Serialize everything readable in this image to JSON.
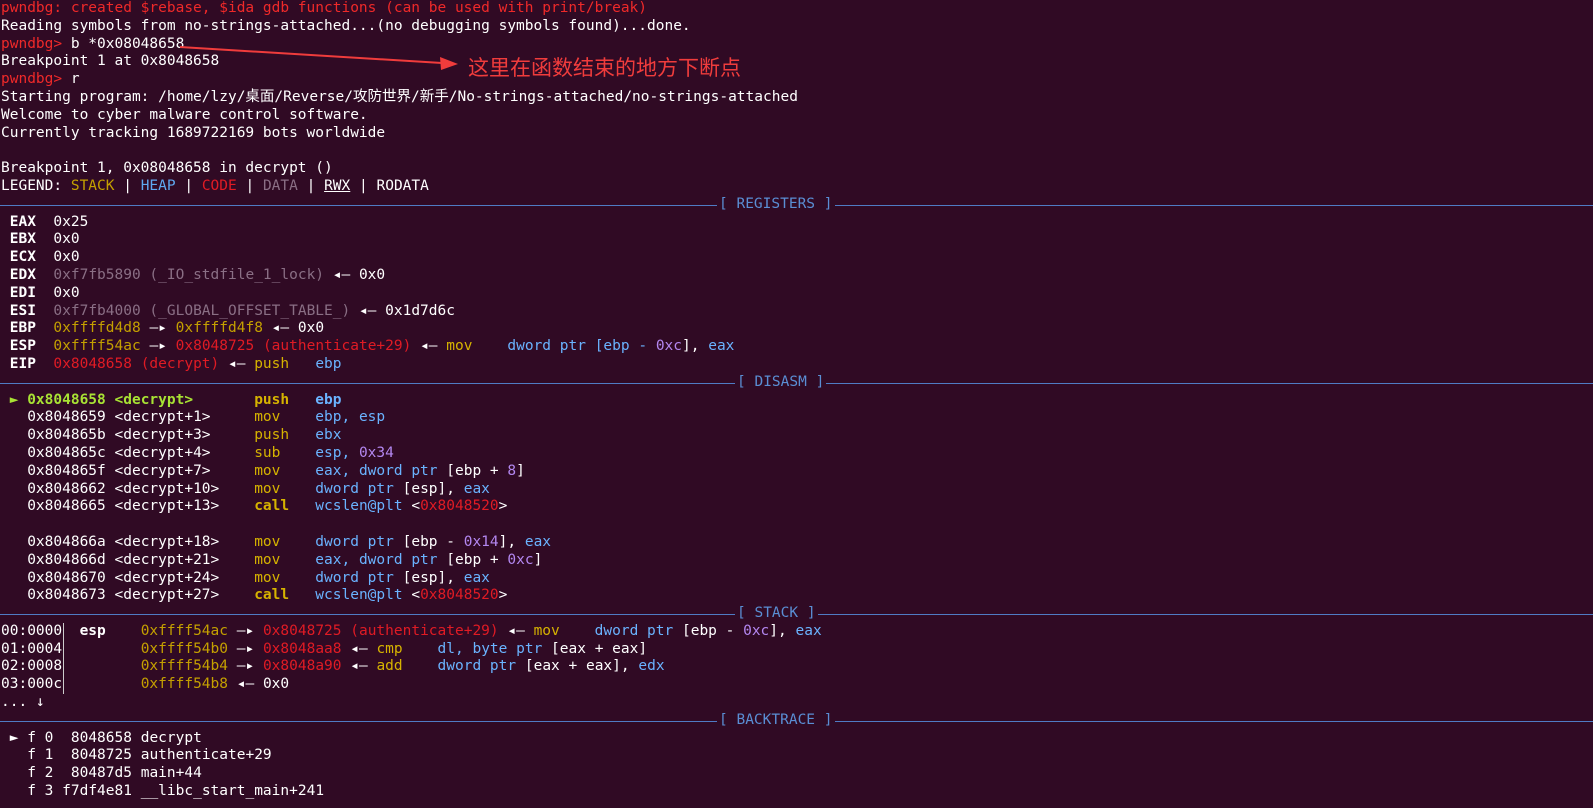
{
  "header_lines": {
    "l0_prompt": "pwndbg:",
    "l0_text": " created $rebase, $ida gdb functions (can be used with print/break)",
    "l1": "Reading symbols from no-strings-attached...(no debugging symbols found)...done.",
    "l2_prompt": "pwndbg>",
    "l2_cmd": " b *0x08048658",
    "l3": "Breakpoint 1 at 0x8048658",
    "l4_prompt": "pwndbg>",
    "l4_cmd": " r",
    "l5": "Starting program: /home/lzy/桌面/Reverse/攻防世界/新手/No-strings-attached/no-strings-attached",
    "l6": "Welcome to cyber malware control software.",
    "l7": "Currently tracking 1689722169 bots worldwide",
    "l9": "Breakpoint 1, 0x08048658 in decrypt ()"
  },
  "legend": {
    "label": "LEGEND: ",
    "stack": "STACK",
    "heap": "HEAP",
    "code": "CODE",
    "data": "DATA",
    "rwx": "RWX",
    "rodata": "RODATA",
    "sep": " | "
  },
  "sections": {
    "registers": "[ REGISTERS ]",
    "disasm": "[ DISASM ]",
    "stack": "[ STACK ]",
    "backtrace": "[ BACKTRACE ]"
  },
  "registers": {
    "eax": {
      "name": "EAX",
      "val": "0x25"
    },
    "ebx": {
      "name": "EBX",
      "val": "0x0"
    },
    "ecx": {
      "name": "ECX",
      "val": "0x0"
    },
    "edx": {
      "name": "EDX",
      "addr": "0xf7fb5890 (_IO_stdfile_1_lock)",
      "arrow": " ◂— ",
      "val": "0x0"
    },
    "edi": {
      "name": "EDI",
      "val": "0x0"
    },
    "esi": {
      "name": "ESI",
      "addr": "0xf7fb4000 (_GLOBAL_OFFSET_TABLE_)",
      "arrow": " ◂— ",
      "val": "0x1d7d6c"
    },
    "ebp": {
      "name": "EBP",
      "a1": "0xffffd4d8",
      "arrow1": " —▸ ",
      "a2": "0xffffd4f8",
      "arrow2": " ◂— ",
      "val": "0x0"
    },
    "esp": {
      "name": "ESP",
      "a1": "0xffff54ac",
      "arrow1": " —▸ ",
      "a2": "0x8048725 (authenticate+29)",
      "arrow2": " ◂— ",
      "mn": "mov",
      "op_a": "dword ptr ",
      "op_b": "[ebp - ",
      "op_c": "0xc",
      "op_d": "], ",
      "op_e": "eax"
    },
    "eip": {
      "name": "EIP",
      "a1": "0x8048658 (decrypt)",
      "arrow1": " ◂— ",
      "mn": "push",
      "op": "ebp"
    }
  },
  "disasm": [
    {
      "marker": "►",
      "addr": "0x8048658",
      "sym": "<decrypt>",
      "mn": "push",
      "op": "ebp",
      "current": true
    },
    {
      "addr": "0x8048659",
      "sym": "<decrypt+1>",
      "mn": "mov",
      "op": "ebp, esp"
    },
    {
      "addr": "0x804865b",
      "sym": "<decrypt+3>",
      "mn": "push",
      "op": "ebx"
    },
    {
      "addr": "0x804865c",
      "sym": "<decrypt+4>",
      "mn": "sub",
      "op_a": "esp, ",
      "op_num": "0x34"
    },
    {
      "addr": "0x804865f",
      "sym": "<decrypt+7>",
      "mn": "mov",
      "op_a": "eax, ",
      "op_b": "dword ptr ",
      "op_c": "[ebp + ",
      "op_num": "8",
      "op_d": "]"
    },
    {
      "addr": "0x8048662",
      "sym": "<decrypt+10>",
      "mn": "mov",
      "op_b": "dword ptr ",
      "op_c": "[esp], ",
      "op_e": "eax"
    },
    {
      "addr": "0x8048665",
      "sym": "<decrypt+13>",
      "mn": "call",
      "op_a": "wcslen@plt ",
      "op_c": "<",
      "op_red": "0x8048520",
      "op_d": ">"
    },
    {
      "blank": true
    },
    {
      "addr": "0x804866a",
      "sym": "<decrypt+18>",
      "mn": "mov",
      "op_b": "dword ptr ",
      "op_c": "[ebp - ",
      "op_num": "0x14",
      "op_d": "], ",
      "op_e": "eax"
    },
    {
      "addr": "0x804866d",
      "sym": "<decrypt+21>",
      "mn": "mov",
      "op_a": "eax, ",
      "op_b": "dword ptr ",
      "op_c": "[ebp + ",
      "op_num": "0xc",
      "op_d": "]"
    },
    {
      "addr": "0x8048670",
      "sym": "<decrypt+24>",
      "mn": "mov",
      "op_b": "dword ptr ",
      "op_c": "[esp], ",
      "op_e": "eax"
    },
    {
      "addr": "0x8048673",
      "sym": "<decrypt+27>",
      "mn": "call",
      "op_a": "wcslen@plt ",
      "op_c": "<",
      "op_red": "0x8048520",
      "op_d": ">"
    }
  ],
  "stack": [
    {
      "off": "00:0000",
      "reg": "esp",
      "a1": "0xffff54ac",
      "ar1": " —▸ ",
      "a2": "0x8048725 (authenticate+29)",
      "ar2": " ◂— ",
      "mn": "mov",
      "op_b": "dword ptr ",
      "op_c": "[ebp - ",
      "op_num": "0xc",
      "op_d": "], ",
      "op_e": "eax"
    },
    {
      "off": "01:0004",
      "reg": "",
      "a1": "0xffff54b0",
      "ar1": " —▸ ",
      "a2": "0x8048aa8",
      "ar2": " ◂— ",
      "mn": "cmp",
      "op_a": "dl, ",
      "op_b": "byte ptr ",
      "op_c": "[eax + eax]"
    },
    {
      "off": "02:0008",
      "reg": "",
      "a1": "0xffff54b4",
      "ar1": " —▸ ",
      "a2": "0x8048a90",
      "ar2": " ◂— ",
      "mn": "add",
      "op_b": "dword ptr ",
      "op_c": "[eax + eax], ",
      "op_e": "edx"
    },
    {
      "off": "03:000c",
      "reg": "",
      "a1": "0xffff54b8",
      "ar2": " ◂— ",
      "val": "0x0"
    }
  ],
  "stack_more": "... ↓",
  "backtrace": [
    {
      "marker": "►",
      "frame": "f 0",
      "addr": " 8048658",
      "name": "decrypt"
    },
    {
      "frame": "f 1",
      "addr": " 8048725",
      "name": "authenticate+29"
    },
    {
      "frame": "f 2",
      "addr": " 80487d5",
      "name": "main+44"
    },
    {
      "frame": "f 3",
      "addr": "f7df4e81",
      "name": "__libc_start_main+241"
    }
  ],
  "annotation": "这里在函数结束的地方下断点",
  "colors": {
    "background": "#300a24",
    "prompt": "#ef2929",
    "section_line": "#4f7bc4",
    "annotation": "#f03c3c"
  }
}
